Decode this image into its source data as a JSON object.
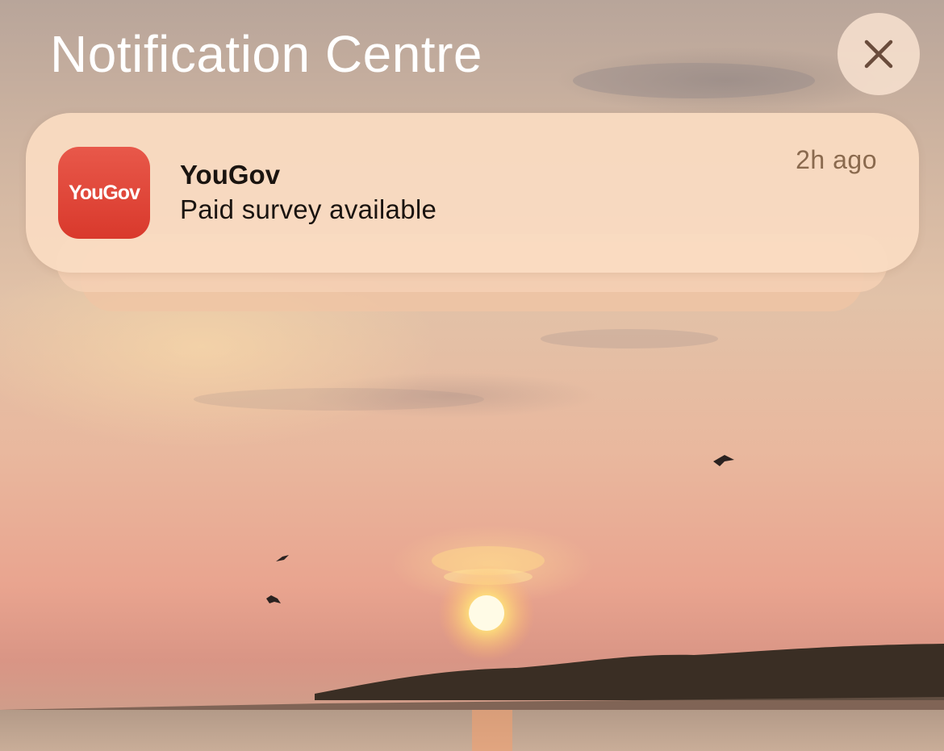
{
  "header": {
    "title": "Notification Centre",
    "close_icon": "close-icon"
  },
  "notification": {
    "app_icon_text": "YouGov",
    "app_name": "YouGov",
    "message": "Paid survey available",
    "time": "2h ago",
    "app_icon_color": "#de4536"
  },
  "wallpaper": {
    "description_icon": "sunset-wallpaper"
  }
}
